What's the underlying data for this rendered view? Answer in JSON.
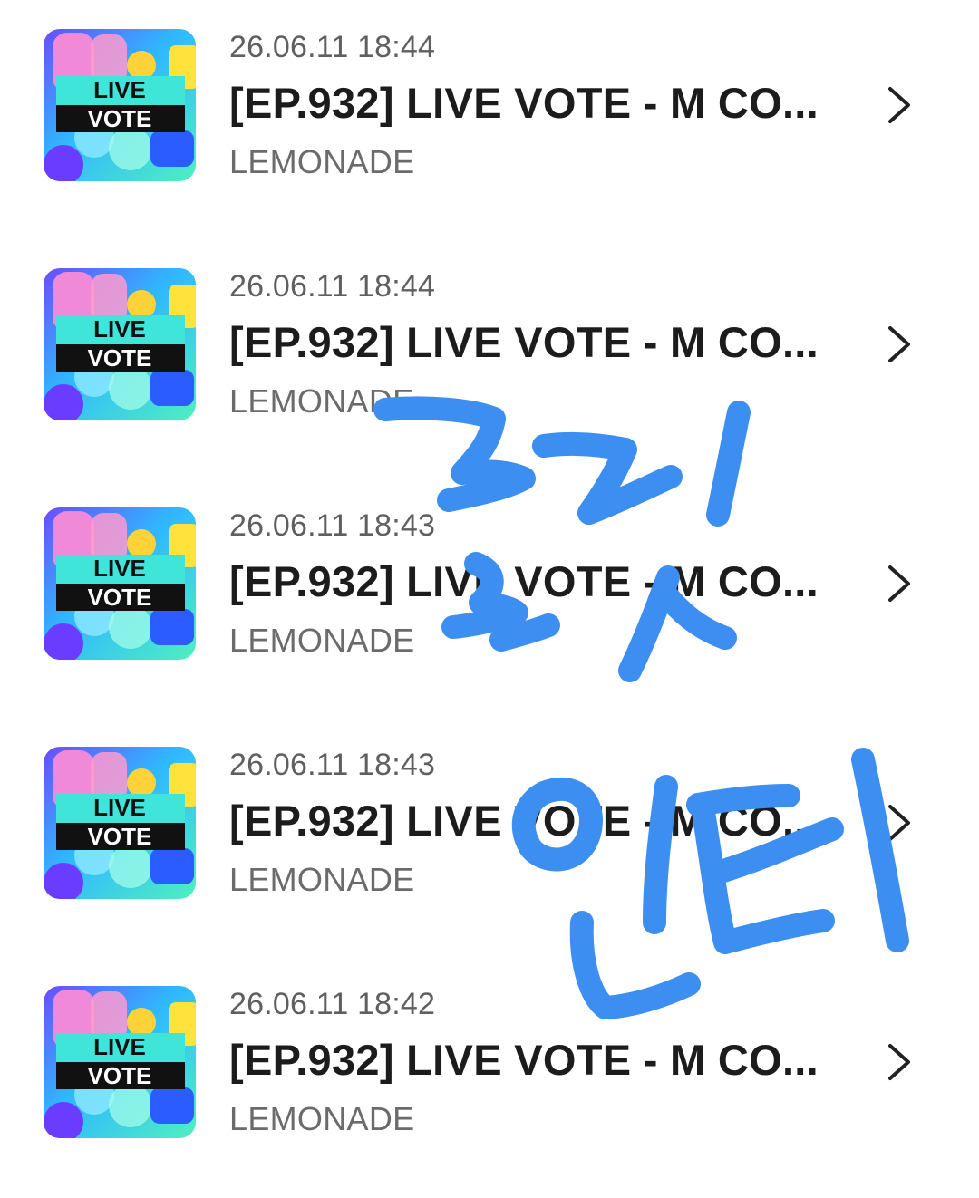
{
  "items": [
    {
      "date": "26.06.11 18:44",
      "title": "[EP.932] LIVE VOTE - M CO...",
      "artist": "LEMONADE",
      "thumb_top": "LIVE",
      "thumb_bottom": "VOTE"
    },
    {
      "date": "26.06.11 18:44",
      "title": "[EP.932] LIVE VOTE - M CO...",
      "artist": "LEMONADE",
      "thumb_top": "LIVE",
      "thumb_bottom": "VOTE"
    },
    {
      "date": "26.06.11 18:43",
      "title": "[EP.932] LIVE VOTE - M CO...",
      "artist": "LEMONADE",
      "thumb_top": "LIVE",
      "thumb_bottom": "VOTE"
    },
    {
      "date": "26.06.11 18:43",
      "title": "[EP.932] LIVE VOTE - M CO...",
      "artist": "LEMONADE",
      "thumb_top": "LIVE",
      "thumb_bottom": "VOTE"
    },
    {
      "date": "26.06.11 18:42",
      "title": "[EP.932] LIVE VOTE - M CO...",
      "artist": "LEMONADE",
      "thumb_top": "LIVE",
      "thumb_bottom": "VOTE"
    }
  ],
  "icons": {
    "row_chevron": "chevron-right-icon"
  },
  "colors": {
    "scribble": "#3c8ff0",
    "date_text": "#5f5f5f",
    "title_text": "#1c1c1c",
    "artist_text": "#6b6b6b",
    "thumb_banner": "#3ee5d8"
  }
}
